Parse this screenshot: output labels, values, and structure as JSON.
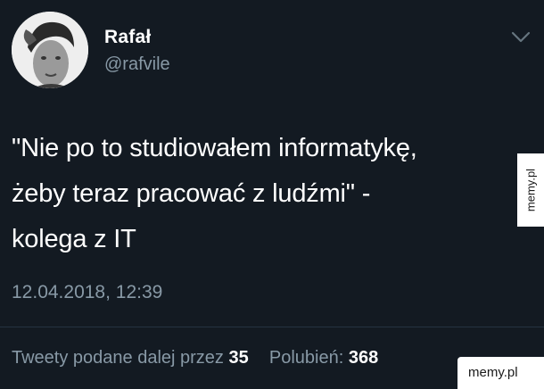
{
  "tweet": {
    "display_name": "Rafał",
    "handle": "@rafvile",
    "text_lines": [
      "\"Nie po to studiowałem informatykę,",
      "żeby teraz pracować z ludźmi\" -",
      "kolega z IT"
    ],
    "timestamp": "12.04.2018, 12:39",
    "stats": {
      "retweets_label": "Tweety podane dalej przez",
      "retweets_count": "35",
      "likes_label": "Polubień:",
      "likes_count": "368"
    }
  },
  "icons": {
    "menu": "chevron-down-icon",
    "avatar": "avatar-photo"
  },
  "watermarks": {
    "side": "memy.pl",
    "corner": "memy.pl"
  },
  "colors": {
    "background": "#131a22",
    "primary_text": "#ffffff",
    "secondary_text": "#8899a6"
  }
}
